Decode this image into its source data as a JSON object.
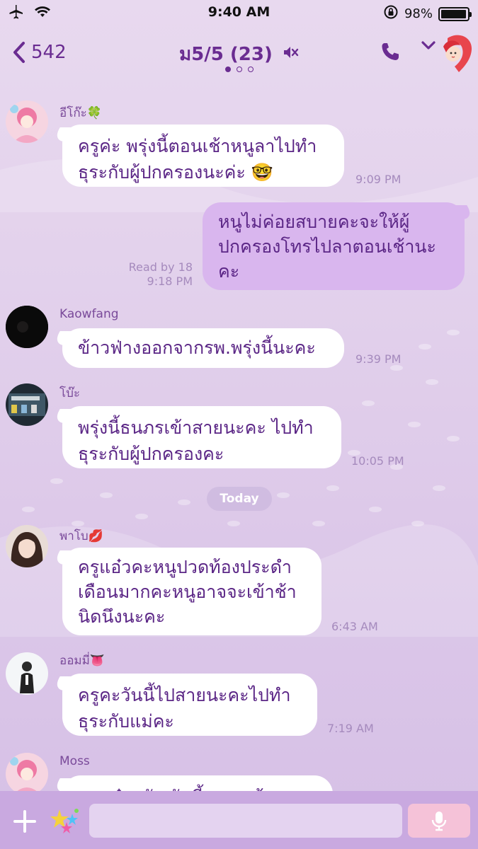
{
  "status_bar": {
    "time": "9:40 AM",
    "battery": "98%",
    "battery_level": 0.98
  },
  "header": {
    "back_count": "542",
    "title": "ม5/5 (23)",
    "page_indicator": {
      "total": 3,
      "active": 0
    }
  },
  "messages": [
    {
      "sender": "อีโก๊ะ🍀",
      "lines": [
        "ครูค่ะ พรุ่งนี้ตอนเช้าหนูลาไปทำ",
        "ธุระกับผู้ปกครองนะค่ะ 🤓"
      ],
      "time": "9:09 PM"
    },
    {
      "sender": "",
      "outgoing": true,
      "lines": [
        "หนูไม่ค่อยสบายคะจะให้ผู้",
        "ปกครองโทรไปลาตอนเช้านะ",
        "คะ"
      ],
      "read": "Read by 18",
      "time": "9:18 PM"
    },
    {
      "sender": "Kaowfang",
      "lines": [
        "ข้าวฟ่างออกจากรพ.พรุ่งนี้นะคะ"
      ],
      "time": "9:39 PM"
    },
    {
      "sender": "โบ๊ะ",
      "lines": [
        "พรุ่งนี้ธนภรเข้าสายนะคะ ไปทำ",
        "ธุระกับผู้ปกครองคะ"
      ],
      "time": "10:05 PM"
    },
    {
      "sender": "พาโบ💋",
      "lines": [
        "ครูแอ๋วคะหนูปวดท้องประดำ",
        "เดือนมากคะหนูอาจจะเข้าช้า",
        "นิดนึงนะคะ"
      ],
      "time": "6:43 AM"
    },
    {
      "sender": "ออมมี่👅",
      "lines": [
        "ครูคะวันนี้ไปสายนะคะไปทำ",
        "ธุระกับแม่คะ"
      ],
      "time": "7:19 AM"
    },
    {
      "sender": "Moss",
      "lines": [
        "ครูแอ๋วครับ วันนี้ผมจะเข้าสายครับ"
      ],
      "time": ""
    }
  ],
  "divider": {
    "label": "Today"
  },
  "composer": {
    "placeholder": ""
  },
  "colors": {
    "accent": "#6a2c91",
    "outgoing_bubble": "#d9b6ee",
    "bottom_bar": "#c9a9e0",
    "mic_button": "#f5c2d8"
  }
}
